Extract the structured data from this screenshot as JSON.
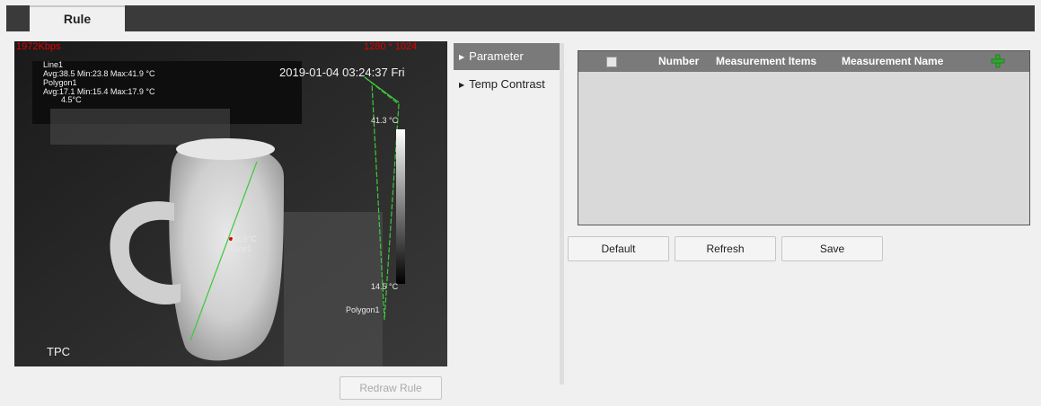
{
  "tabs": [
    {
      "label": "Rule"
    }
  ],
  "video": {
    "bitrate": "1972Kbps",
    "resolution": "1280 * 1024",
    "timestamp": "2019-01-04 03:24:37 Fri",
    "overlay_lines": [
      "Line1",
      "Avg:38.5 Min:23.8 Max:41.9 °C",
      "Polygon1",
      "Avg:17.1 Min:15.4 Max:17.9 °C"
    ],
    "small_temp": "4.5°C",
    "scale_max": "41.3 °C",
    "scale_min": "14.5 °C",
    "line_label": "Line1",
    "line_temp": "41.9°C",
    "polygon_label": "Polygon1",
    "brand": "TPC"
  },
  "redraw_button": "Redraw Rule",
  "menu": {
    "items": [
      {
        "label": "Parameter",
        "active": true
      },
      {
        "label": "Temp Contrast",
        "active": false
      }
    ]
  },
  "table": {
    "columns": [
      "Number",
      "Measurement Items",
      "Measurement Name"
    ],
    "rows": []
  },
  "buttons": {
    "default": "Default",
    "refresh": "Refresh",
    "save": "Save"
  },
  "colors": {
    "accent_add": "#2ea82e",
    "header_bg": "#7a7a7a",
    "rule_line": "#3ec83e",
    "overlay_red": "#e00000"
  }
}
